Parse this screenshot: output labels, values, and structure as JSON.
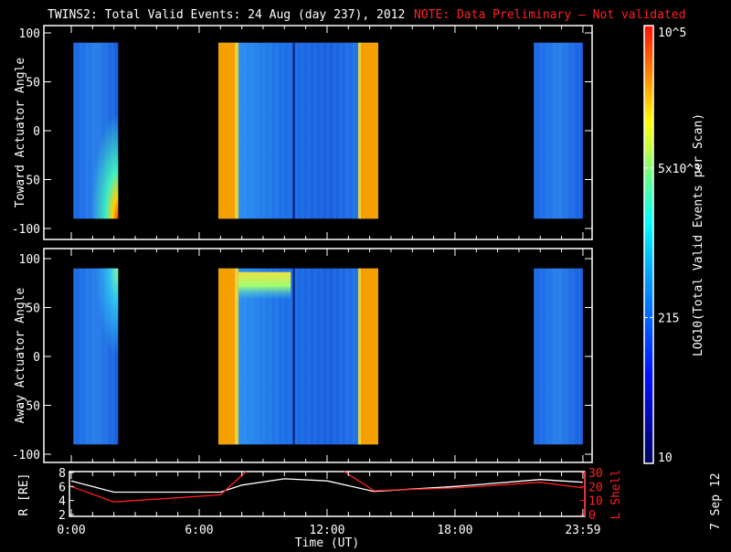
{
  "title": {
    "main": "TWINS2: Total Valid Events: 24 Aug (day 237), 2012",
    "note": "NOTE: Data Preliminary — Not validated"
  },
  "date_stamp": "7 Sep 12",
  "colors": {
    "frame": "#ffffff",
    "note": "#ff2020",
    "r_line": "#ffffff",
    "l_line": "#ff2020",
    "low": "#1a5ee8",
    "high": "#f5a000"
  },
  "chart_data": [
    {
      "type": "heatmap",
      "panel": "toward",
      "ylabel": "Toward Actuator Angle",
      "yticks": [
        100,
        50,
        0,
        -50,
        -100
      ],
      "ylim": [
        -110,
        110
      ],
      "xlim_hours": [
        0,
        24
      ],
      "angle_range": [
        -90,
        90
      ],
      "blocks": [
        {
          "start": 0.1,
          "end": 2.2,
          "level": "low",
          "hot_corner": "bottom-right"
        },
        {
          "start": 6.9,
          "end": 14.4,
          "level": "low",
          "edges": "high"
        },
        {
          "start": 21.7,
          "end": 24.0,
          "level": "low"
        }
      ]
    },
    {
      "type": "heatmap",
      "panel": "away",
      "ylabel": "Away Actuator Angle",
      "yticks": [
        100,
        50,
        0,
        -50,
        -100
      ],
      "ylim": [
        -110,
        110
      ],
      "xlim_hours": [
        0,
        24
      ],
      "angle_range": [
        -90,
        90
      ],
      "blocks": [
        {
          "start": 0.1,
          "end": 2.2,
          "level": "low",
          "hot_corner": "top-right"
        },
        {
          "start": 6.9,
          "end": 14.4,
          "level": "low",
          "edges": "high",
          "hot_band": "top"
        },
        {
          "start": 21.7,
          "end": 24.0,
          "level": "low"
        }
      ]
    },
    {
      "type": "line",
      "panel": "orbit",
      "ylabel_left": "R [RE]",
      "ylabel_right": "L Shell",
      "yticks_left": [
        8,
        6,
        4,
        2
      ],
      "yticks_right": [
        30,
        20,
        10,
        0
      ],
      "ylim_left": [
        2,
        8
      ],
      "ylim_right": [
        0,
        30
      ],
      "xlabel": "Time (UT)",
      "xticks": [
        {
          "h": 0,
          "label": "0:00"
        },
        {
          "h": 6,
          "label": "6:00"
        },
        {
          "h": 12,
          "label": "12:00"
        },
        {
          "h": 18,
          "label": "18:00"
        },
        {
          "h": 24,
          "label": "23:59"
        }
      ],
      "series": [
        {
          "name": "R",
          "x": [
            0,
            2,
            7,
            8,
            10,
            12,
            14.2,
            18,
            22,
            24
          ],
          "y": [
            6.8,
            5.2,
            5.2,
            6.2,
            7.1,
            6.8,
            5.3,
            6.0,
            7.0,
            6.6
          ]
        },
        {
          "name": "L Shell",
          "x": [
            0,
            2,
            7,
            8.2,
            8.2,
            12.8,
            12.8,
            14.2,
            18,
            22,
            24
          ],
          "y": [
            20,
            9,
            14,
            31,
            null,
            null,
            31,
            17,
            19,
            23,
            19
          ]
        }
      ]
    }
  ],
  "colorbar": {
    "label": "LOG10(Total Valid Events per Scan)",
    "ticks": [
      {
        "value": 100000,
        "label": "10^5"
      },
      {
        "value": 5000,
        "label": "5x10^3"
      },
      {
        "value": 215,
        "label": "215"
      },
      {
        "value": 10,
        "label": "10"
      }
    ]
  }
}
